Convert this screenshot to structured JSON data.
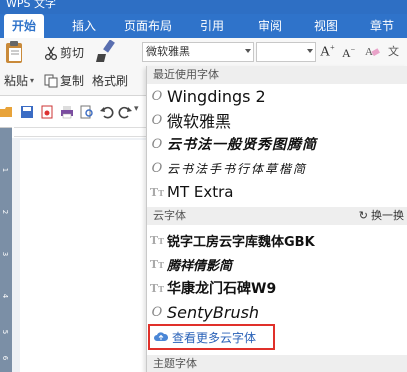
{
  "window": {
    "title": "WPS 文字"
  },
  "tabs": [
    {
      "label": "开始"
    },
    {
      "label": "插入"
    },
    {
      "label": "页面布局"
    },
    {
      "label": "引用"
    },
    {
      "label": "审阅"
    },
    {
      "label": "视图"
    },
    {
      "label": "章节"
    }
  ],
  "ribbon": {
    "paste_label": "粘贴",
    "cut_label": "剪切",
    "copy_label": "复制",
    "format_painter_label": "格式刷",
    "font_name": "微软雅黑",
    "size_value": ""
  },
  "vruler_ticks": [
    "1",
    "2",
    "3",
    "4",
    "5",
    "6"
  ],
  "font_panel": {
    "recent_header": "最近使用字体",
    "recent_fonts": [
      {
        "name": "Wingdings 2",
        "type_icon": "opentype-icon"
      },
      {
        "name": "微软雅黑",
        "type_icon": "opentype-icon"
      },
      {
        "name": "云书法一般贤秀图腾简",
        "type_icon": "opentype-icon"
      },
      {
        "name": "云书法手书行体草楷简",
        "type_icon": "opentype-icon"
      },
      {
        "name": "MT Extra",
        "type_icon": "truetype-icon"
      }
    ],
    "cloud_header": "云字体",
    "swap_label": "换一换",
    "cloud_fonts": [
      {
        "name": "锐字工房云字库魏体GBK",
        "type_icon": "truetype-icon"
      },
      {
        "name": "腾祥倩影简",
        "type_icon": "truetype-icon"
      },
      {
        "name": "华康龙门石碑W9",
        "type_icon": "truetype-icon"
      },
      {
        "name": "SentyBrush",
        "type_icon": "opentype-icon"
      }
    ],
    "more_cloud_label": "查看更多云字体",
    "theme_header": "主题字体"
  },
  "colors": {
    "tabbar": "#2f73ca",
    "ribbon_bg": "#f7f7f7",
    "highlight_border": "#e0302a",
    "link": "#2a62b8"
  }
}
